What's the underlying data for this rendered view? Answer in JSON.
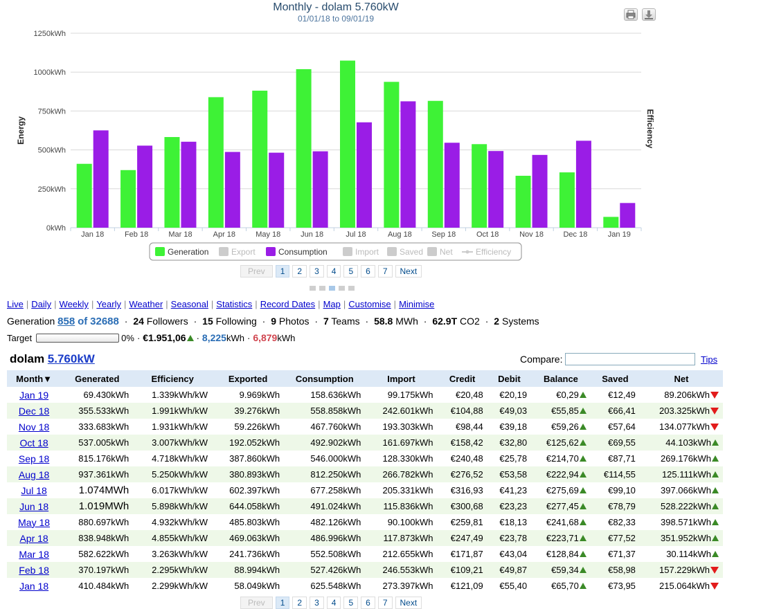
{
  "chart": {
    "title": "Monthly - dolam 5.760kW",
    "subtitle": "01/01/18 to 09/01/19",
    "print_icon": "print-icon",
    "download_icon": "download-icon"
  },
  "chart_data": {
    "type": "bar",
    "title": "Monthly - dolam 5.760kW",
    "subtitle": "01/01/18 to 09/01/19",
    "ylabel": "Energy",
    "y2label": "Efficiency",
    "ylim": [
      0,
      1250
    ],
    "yticks": [
      "0kWh",
      "250kWh",
      "500kWh",
      "750kWh",
      "1000kWh",
      "1250kWh"
    ],
    "ytick_values": [
      0,
      250,
      500,
      750,
      1000,
      1250
    ],
    "categories": [
      "Jan 18",
      "Feb 18",
      "Mar 18",
      "Apr 18",
      "May 18",
      "Jun 18",
      "Jul 18",
      "Aug 18",
      "Sep 18",
      "Oct 18",
      "Nov 18",
      "Dec 18",
      "Jan 19"
    ],
    "series": [
      {
        "name": "Generation",
        "color": "#3ef236",
        "values": [
          410.484,
          370.197,
          582.622,
          838.948,
          880.697,
          1019,
          1074,
          937.361,
          815.176,
          537.005,
          333.683,
          355.533,
          69.43
        ]
      },
      {
        "name": "Consumption",
        "color": "#9a1de6",
        "values": [
          625.548,
          527.426,
          552.508,
          486.996,
          482.126,
          491.024,
          677.258,
          812.25,
          546.0,
          492.902,
          467.76,
          558.858,
          158.636
        ]
      }
    ],
    "legend": {
      "placement": "bottom-center",
      "items": [
        {
          "name": "Generation",
          "color": "#3ef236",
          "enabled": true,
          "marker": "box"
        },
        {
          "name": "Export",
          "color": "#cccccc",
          "enabled": false,
          "marker": "box"
        },
        {
          "name": "Consumption",
          "color": "#9a1de6",
          "enabled": true,
          "marker": "box"
        },
        {
          "name": "Import",
          "color": "#cccccc",
          "enabled": false,
          "marker": "box"
        },
        {
          "name": "Saved",
          "color": "#cccccc",
          "enabled": false,
          "marker": "box"
        },
        {
          "name": "Net",
          "color": "#cccccc",
          "enabled": false,
          "marker": "box"
        },
        {
          "name": "Efficiency",
          "color": "#cccccc",
          "enabled": false,
          "marker": "line"
        }
      ]
    },
    "grid": true
  },
  "pager_top": {
    "prev": "Prev",
    "pages": [
      "1",
      "2",
      "3",
      "4",
      "5",
      "6",
      "7"
    ],
    "active": "1",
    "next": "Next"
  },
  "pager_bottom": {
    "prev": "Prev",
    "pages": [
      "1",
      "2",
      "3",
      "4",
      "5",
      "6",
      "7"
    ],
    "active": "1",
    "next": "Next"
  },
  "nav": [
    "Live",
    "Daily",
    "Weekly",
    "Yearly",
    "Weather",
    "Seasonal",
    "Statistics",
    "Record Dates",
    "Map",
    "Customise",
    "Minimise"
  ],
  "stats": {
    "generation_label": "Generation",
    "rank": "858",
    "of_label": "of",
    "total": "32688",
    "followers_num": "24",
    "followers_label": "Followers",
    "following_num": "15",
    "following_label": "Following",
    "photos_num": "9",
    "photos_label": "Photos",
    "teams_num": "7",
    "teams_label": "Teams",
    "energy": "58.8",
    "energy_unit": "MWh",
    "co2": "62.9T",
    "co2_unit": "CO2",
    "systems_num": "2",
    "systems_label": "Systems"
  },
  "target": {
    "label": "Target",
    "percent": "0%",
    "money": "€1.951,06",
    "export_value": "8,225",
    "export_unit": "kWh",
    "import_value": "6,879",
    "import_unit": "kWh"
  },
  "system": {
    "name": "dolam",
    "size": "5.760kW"
  },
  "compare": {
    "label": "Compare:",
    "value": ""
  },
  "tips": "Tips",
  "table": {
    "headers": [
      "Month▼",
      "Generated",
      "Efficiency",
      "Exported",
      "Consumption",
      "Import",
      "Credit",
      "Debit",
      "Balance",
      "Saved",
      "Net"
    ],
    "rows": [
      {
        "month": "Jan 19",
        "generated": "69.430kWh",
        "efficiency": "1.339kWh/kW",
        "exported": "9.969kWh",
        "consumption": "158.636kWh",
        "import": "99.175kWh",
        "credit": "€20,48",
        "debit": "€20,19",
        "balance": "€0,29",
        "saved": "€12,49",
        "net": "89.206kWh",
        "net_dir": "down"
      },
      {
        "month": "Dec 18",
        "generated": "355.533kWh",
        "efficiency": "1.991kWh/kW",
        "exported": "39.276kWh",
        "consumption": "558.858kWh",
        "import": "242.601kWh",
        "credit": "€104,88",
        "debit": "€49,03",
        "balance": "€55,85",
        "saved": "€66,41",
        "net": "203.325kWh",
        "net_dir": "down"
      },
      {
        "month": "Nov 18",
        "generated": "333.683kWh",
        "efficiency": "1.931kWh/kW",
        "exported": "59.226kWh",
        "consumption": "467.760kWh",
        "import": "193.303kWh",
        "credit": "€98,44",
        "debit": "€39,18",
        "balance": "€59,26",
        "saved": "€57,64",
        "net": "134.077kWh",
        "net_dir": "down"
      },
      {
        "month": "Oct 18",
        "generated": "537.005kWh",
        "efficiency": "3.007kWh/kW",
        "exported": "192.052kWh",
        "consumption": "492.902kWh",
        "import": "161.697kWh",
        "credit": "€158,42",
        "debit": "€32,80",
        "balance": "€125,62",
        "saved": "€69,55",
        "net": "44.103kWh",
        "net_dir": "up"
      },
      {
        "month": "Sep 18",
        "generated": "815.176kWh",
        "efficiency": "4.718kWh/kW",
        "exported": "387.860kWh",
        "consumption": "546.000kWh",
        "import": "128.330kWh",
        "credit": "€240,48",
        "debit": "€25,78",
        "balance": "€214,70",
        "saved": "€87,71",
        "net": "269.176kWh",
        "net_dir": "up"
      },
      {
        "month": "Aug 18",
        "generated": "937.361kWh",
        "efficiency": "5.250kWh/kW",
        "exported": "380.893kWh",
        "consumption": "812.250kWh",
        "import": "266.782kWh",
        "credit": "€276,52",
        "debit": "€53,58",
        "balance": "€222,94",
        "saved": "€114,55",
        "net": "125.111kWh",
        "net_dir": "up"
      },
      {
        "month": "Jul 18",
        "generated": "1.074MWh",
        "efficiency": "6.017kWh/kW",
        "exported": "602.397kWh",
        "consumption": "677.258kWh",
        "import": "205.331kWh",
        "credit": "€316,93",
        "debit": "€41,23",
        "balance": "€275,69",
        "saved": "€99,10",
        "net": "397.066kWh",
        "net_dir": "up",
        "big": true
      },
      {
        "month": "Jun 18",
        "generated": "1.019MWh",
        "efficiency": "5.898kWh/kW",
        "exported": "644.058kWh",
        "consumption": "491.024kWh",
        "import": "115.836kWh",
        "credit": "€300,68",
        "debit": "€23,23",
        "balance": "€277,45",
        "saved": "€78,79",
        "net": "528.222kWh",
        "net_dir": "up",
        "big": true
      },
      {
        "month": "May 18",
        "generated": "880.697kWh",
        "efficiency": "4.932kWh/kW",
        "exported": "485.803kWh",
        "consumption": "482.126kWh",
        "import": "90.100kWh",
        "credit": "€259,81",
        "debit": "€18,13",
        "balance": "€241,68",
        "saved": "€82,33",
        "net": "398.571kWh",
        "net_dir": "up"
      },
      {
        "month": "Apr 18",
        "generated": "838.948kWh",
        "efficiency": "4.855kWh/kW",
        "exported": "469.063kWh",
        "consumption": "486.996kWh",
        "import": "117.873kWh",
        "credit": "€247,49",
        "debit": "€23,78",
        "balance": "€223,71",
        "saved": "€77,52",
        "net": "351.952kWh",
        "net_dir": "up"
      },
      {
        "month": "Mar 18",
        "generated": "582.622kWh",
        "efficiency": "3.263kWh/kW",
        "exported": "241.736kWh",
        "consumption": "552.508kWh",
        "import": "212.655kWh",
        "credit": "€171,87",
        "debit": "€43,04",
        "balance": "€128,84",
        "saved": "€71,37",
        "net": "30.114kWh",
        "net_dir": "up"
      },
      {
        "month": "Feb 18",
        "generated": "370.197kWh",
        "efficiency": "2.295kWh/kW",
        "exported": "88.994kWh",
        "consumption": "527.426kWh",
        "import": "246.553kWh",
        "credit": "€109,21",
        "debit": "€49,87",
        "balance": "€59,34",
        "saved": "€58,98",
        "net": "157.229kWh",
        "net_dir": "down"
      },
      {
        "month": "Jan 18",
        "generated": "410.484kWh",
        "efficiency": "2.299kWh/kW",
        "exported": "58.049kWh",
        "consumption": "625.548kWh",
        "import": "273.397kWh",
        "credit": "€121,09",
        "debit": "€55,40",
        "balance": "€65,70",
        "saved": "€73,95",
        "net": "215.064kWh",
        "net_dir": "down"
      }
    ]
  }
}
